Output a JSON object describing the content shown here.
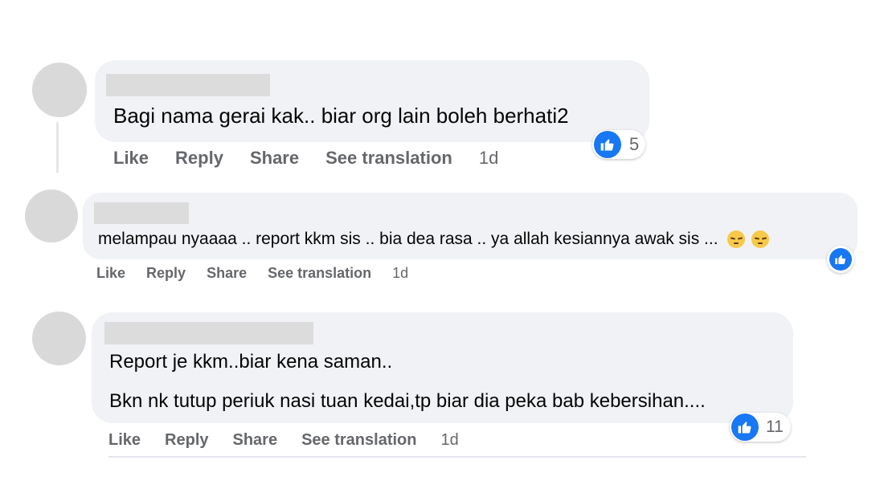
{
  "comments": [
    {
      "text_lines": [
        "Bagi nama gerai kak.. biar org lain boleh berhati2"
      ],
      "actions": {
        "like": "Like",
        "reply": "Reply",
        "share": "Share",
        "translate": "See translation",
        "time": "1d"
      },
      "reaction_count": "5"
    },
    {
      "text_lines": [
        "melampau nyaaaa .. report kkm sis .. bia dea rasa .. ya allah kesiannya awak sis ..."
      ],
      "emojis": [
        "pensive-face",
        "pensive-face"
      ],
      "actions": {
        "like": "Like",
        "reply": "Reply",
        "share": "Share",
        "translate": "See translation",
        "time": "1d"
      },
      "reaction_count": ""
    },
    {
      "text_lines": [
        "Report je kkm..biar kena saman..",
        "Bkn nk tutup periuk nasi tuan kedai,tp biar dia peka bab kebersihan...."
      ],
      "actions": {
        "like": "Like",
        "reply": "Reply",
        "share": "Share",
        "translate": "See translation",
        "time": "1d"
      },
      "reaction_count": "11"
    }
  ],
  "colors": {
    "like_blue": "#1877f2",
    "bubble": "#f0f2f5",
    "meta_gray": "#65676b"
  }
}
